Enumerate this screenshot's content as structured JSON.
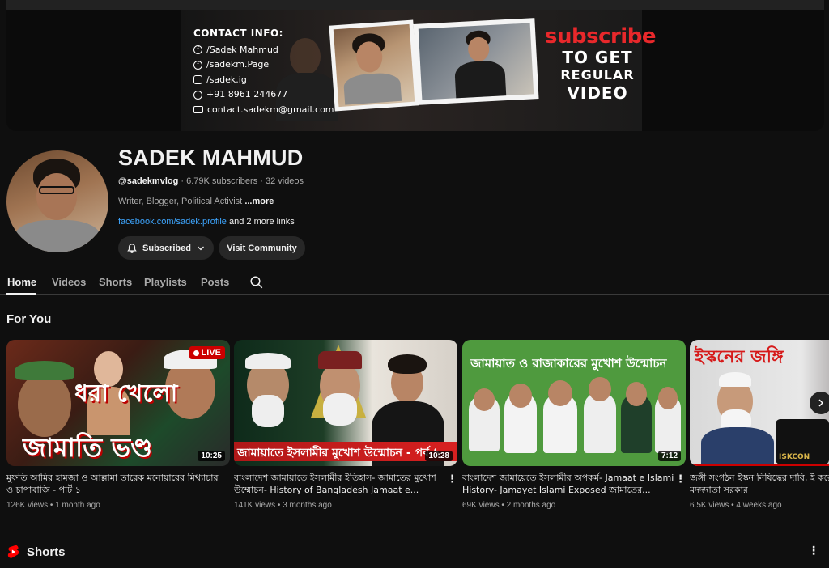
{
  "banner": {
    "contact_heading": "CONTACT INFO:",
    "contacts": [
      {
        "icon": "facebook-icon",
        "text": "/Sadek Mahmud"
      },
      {
        "icon": "facebook-icon",
        "text": "/sadekm.Page"
      },
      {
        "icon": "instagram-icon",
        "text": "/sadek.ig"
      },
      {
        "icon": "whatsapp-icon",
        "text": "+91 8961 244677"
      },
      {
        "icon": "email-icon",
        "text": "contact.sadekm@gmail.com"
      }
    ],
    "subscribe_word": "subscribe",
    "to_get": "TO GET",
    "regular": "REGULAR",
    "video": "VIDEO"
  },
  "channel": {
    "name": "SADEK MAHMUD",
    "handle": "@sadekmvlog",
    "subscribers": "6.79K subscribers",
    "videos": "32 videos",
    "description": "Writer, Blogger, Political Activist",
    "more": "...more",
    "link": "facebook.com/sadek.profile",
    "more_links": "and 2 more links",
    "subscribed_label": "Subscribed",
    "community_label": "Visit Community"
  },
  "tabs": {
    "home": "Home",
    "videos": "Videos",
    "shorts": "Shorts",
    "playlists": "Playlists",
    "posts": "Posts"
  },
  "for_you": {
    "title": "For You",
    "cards": [
      {
        "title": "মুফতি আমির হামজা ও আল্লামা তারেক মনোয়ারের মিথ্যাচার ও চাপাবাজি - পার্ট ১",
        "views": "126K views",
        "age": "1 month ago",
        "duration": "10:25",
        "live": "LIVE",
        "thumb_text_top": "ধরা খেলো",
        "thumb_text_bottom": "জামাতি ভণ্ড"
      },
      {
        "title": "বাংলাদেশ জামায়াতে ইসলামীর ইতিহাস- জামাতের মুখোশ উম্মোচন- History of Bangladesh Jamaat e...",
        "views": "141K views",
        "age": "3 months ago",
        "duration": "10:28",
        "thumb_text": "জামায়াতে ইসলামীর মুখোশ উন্মোচন - পর্ব ১"
      },
      {
        "title": "বাংলাদেশ জামায়েতে ইসলামীর অপকর্ম- Jamaat e Islami History- Jamayet Islami Exposed জামাতের...",
        "views": "69K views",
        "age": "2 months ago",
        "duration": "7:12",
        "thumb_text": "জামায়াত ও রাজাকারের মুখোশ উন্মোচন"
      },
      {
        "title": "জঙ্গী সংগঠন ইস্কন নিষিদ্ধের দাবি, ই করেছে? জঙ্গিদের মদদদাতা সরকার",
        "views": "6.5K views",
        "age": "4 weeks ago",
        "thumb_text": "ইস্কনের জঙ্গি",
        "thumb_badge": "ISKCON"
      }
    ]
  },
  "shorts_section": {
    "title": "Shorts"
  },
  "colors": {
    "background": "#0f0f0f",
    "accent_red": "#cc0000",
    "link_blue": "#3ea6ff",
    "chip": "#272727"
  }
}
